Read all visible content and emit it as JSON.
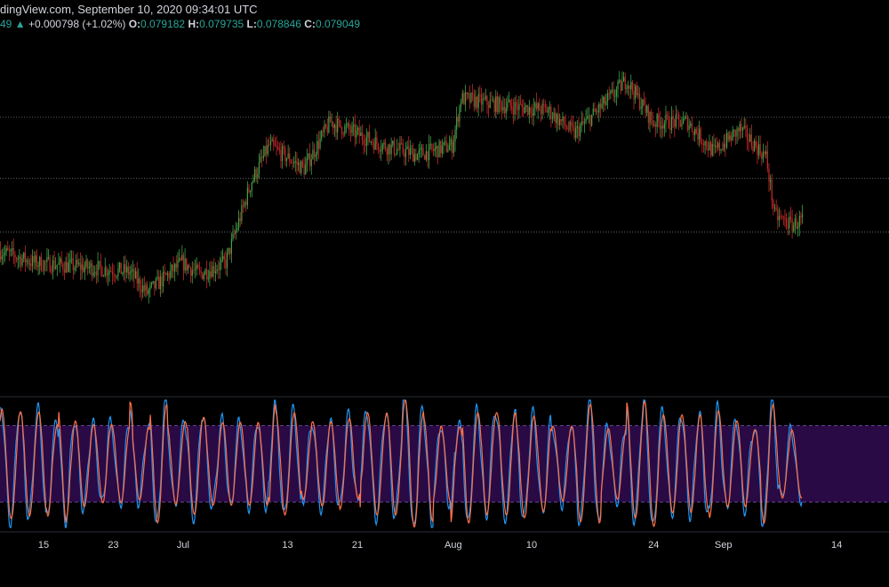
{
  "header": {
    "line1": "dingView.com, September 10, 2020 09:34:01 UTC",
    "prefix": "49",
    "change_arrow": "▲",
    "change": "+0.000798 (+1.02%)",
    "o_label": "O:",
    "o_value": "0.079182",
    "h_label": "H:",
    "h_value": "0.079735",
    "l_label": "L:",
    "l_value": "0.078846",
    "c_label": "C:",
    "c_value": "0.079049"
  },
  "colors": {
    "up": "#26a69a",
    "down": "#ef5350",
    "candle_up": "#43a047",
    "candle_down": "#c62828",
    "stoch_k": "#2196f3",
    "stoch_d": "#ff7043",
    "stoch_band": "#2a0a44",
    "grid": "#787b86"
  },
  "chart_data": {
    "type": "candlestick",
    "x_ticks": [
      "15",
      "23",
      "Jul",
      "13",
      "21",
      "Aug",
      "10",
      "24",
      "Sep",
      "14"
    ],
    "x_tick_dates": [
      "2020-06-15",
      "2020-06-23",
      "2020-07-01",
      "2020-07-13",
      "2020-07-21",
      "2020-08-01",
      "2020-08-10",
      "2020-08-24",
      "2020-09-01",
      "2020-09-14"
    ],
    "x_range": [
      "2020-06-10",
      "2020-09-20"
    ],
    "price_range": [
      0.0685,
      0.0835
    ],
    "horizontal_levels": [
      0.0802,
      0.0776,
      0.0753
    ],
    "price_path": [
      [
        "2020-06-10",
        0.0745
      ],
      [
        "2020-06-14",
        0.074
      ],
      [
        "2020-06-20",
        0.0738
      ],
      [
        "2020-06-25",
        0.0736
      ],
      [
        "2020-06-27",
        0.0727
      ],
      [
        "2020-07-01",
        0.074
      ],
      [
        "2020-07-03",
        0.0735
      ],
      [
        "2020-07-06",
        0.074
      ],
      [
        "2020-07-09",
        0.0775
      ],
      [
        "2020-07-11",
        0.079
      ],
      [
        "2020-07-15",
        0.078
      ],
      [
        "2020-07-18",
        0.08
      ],
      [
        "2020-07-24",
        0.079
      ],
      [
        "2020-07-28",
        0.0786
      ],
      [
        "2020-08-01",
        0.079
      ],
      [
        "2020-08-02",
        0.081
      ],
      [
        "2020-08-07",
        0.0807
      ],
      [
        "2020-08-12",
        0.0805
      ],
      [
        "2020-08-15",
        0.0795
      ],
      [
        "2020-08-19",
        0.081
      ],
      [
        "2020-08-21",
        0.0818
      ],
      [
        "2020-08-24",
        0.08
      ],
      [
        "2020-08-28",
        0.08
      ],
      [
        "2020-08-31",
        0.0787
      ],
      [
        "2020-09-03",
        0.0797
      ],
      [
        "2020-09-06",
        0.0785
      ],
      [
        "2020-09-07",
        0.076
      ],
      [
        "2020-09-09",
        0.0756
      ],
      [
        "2020-09-10",
        0.0758
      ]
    ],
    "stochastic": {
      "range": [
        0,
        100
      ],
      "upper_band": 80,
      "lower_band": 20,
      "period_days": 2.1
    }
  }
}
